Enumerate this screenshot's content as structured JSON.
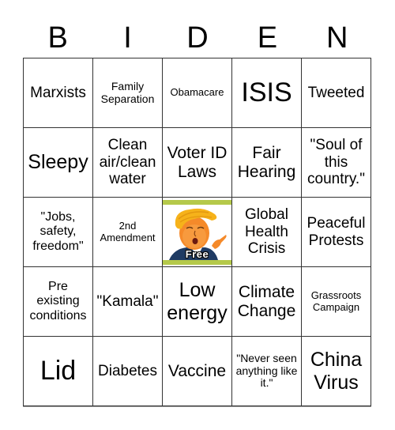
{
  "header": {
    "letters": [
      "B",
      "I",
      "D",
      "E",
      "N"
    ]
  },
  "grid": {
    "rows": [
      [
        "Marxists",
        "Family Separation",
        "Obamacare",
        "ISIS",
        "Tweeted"
      ],
      [
        "Sleepy",
        "Clean air/clean water",
        "Voter ID Laws",
        "Fair Hearing",
        "\"Soul of this country.\""
      ],
      [
        "\"Jobs, safety, freedom\"",
        "2nd Amendment",
        "Free",
        "Global Health Crisis",
        "Peaceful Protests"
      ],
      [
        "Pre existing conditions",
        "\"Kamala\"",
        "Low energy",
        "Climate Change",
        "Grassroots Campaign"
      ],
      [
        "Lid",
        "Diabetes",
        "Vaccine",
        "\"Never seen anything like it.\"",
        "China Virus"
      ]
    ]
  },
  "free_space": {
    "label": "Free",
    "image": "cartoon-caricature-pointing",
    "frame_color": "#b5c94a"
  }
}
